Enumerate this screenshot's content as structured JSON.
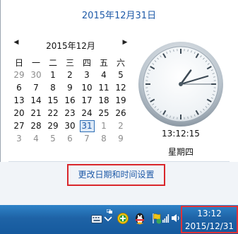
{
  "header": {
    "date_title": "2015年12月31日"
  },
  "calendar": {
    "prev_icon": "◀",
    "next_icon": "▶",
    "month_label": "2015年12月",
    "weekdays": [
      "日",
      "一",
      "二",
      "三",
      "四",
      "五",
      "六"
    ],
    "weeks": [
      [
        "29",
        "30",
        "1",
        "2",
        "3",
        "4",
        "5"
      ],
      [
        "6",
        "7",
        "8",
        "9",
        "10",
        "11",
        "12"
      ],
      [
        "13",
        "14",
        "15",
        "16",
        "17",
        "18",
        "19"
      ],
      [
        "20",
        "21",
        "22",
        "23",
        "24",
        "25",
        "26"
      ],
      [
        "27",
        "28",
        "29",
        "30",
        "31",
        "1",
        "2"
      ],
      [
        "3",
        "4",
        "5",
        "6",
        "7",
        "8",
        "9"
      ]
    ],
    "selected_day": "31"
  },
  "clock": {
    "time": "13:12:15",
    "weekday": "星期四"
  },
  "footer": {
    "change_settings_link": "更改日期和时间设置"
  },
  "taskbar": {
    "time": "13:12",
    "date": "2015/12/31",
    "colors": {
      "taskbar": "#1e63a6",
      "highlight_box": "#e23236"
    }
  }
}
